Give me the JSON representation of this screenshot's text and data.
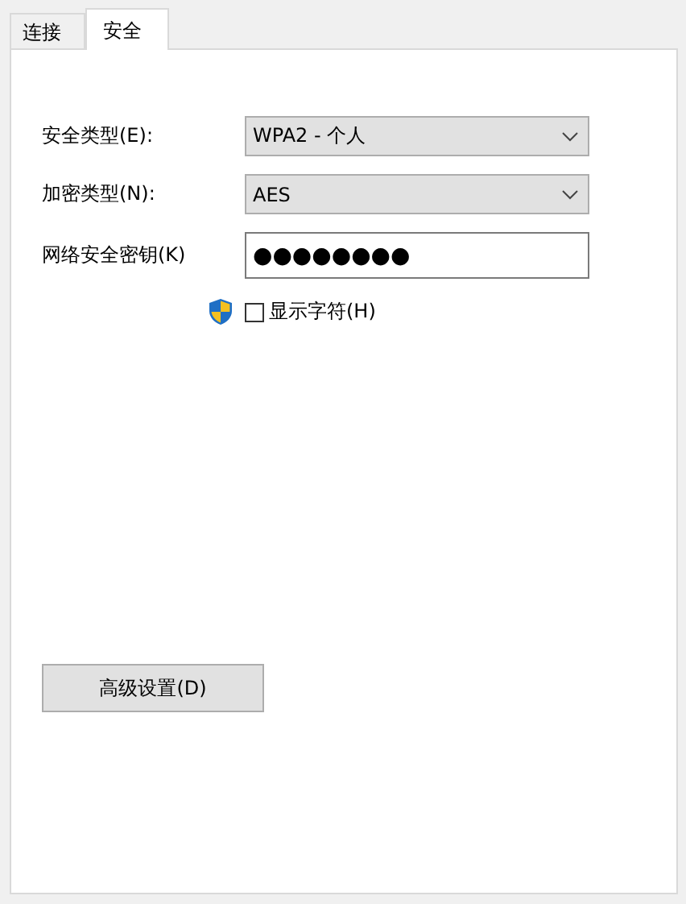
{
  "tabs": [
    {
      "label": "连接",
      "selected": false
    },
    {
      "label": "安全",
      "selected": true
    }
  ],
  "fields": [
    {
      "kind": "dropdown",
      "label": "安全类型(E):",
      "value": "WPA2 - 个人"
    },
    {
      "kind": "dropdown",
      "label": "加密类型(N):",
      "value": "AES"
    },
    {
      "kind": "password",
      "label": "网络安全密钥(K)",
      "value": "●●●●●●●●"
    }
  ],
  "show_characters": {
    "label": "显示字符(H)",
    "checked": false
  },
  "advanced_button": {
    "label": "高级设置(D)"
  }
}
